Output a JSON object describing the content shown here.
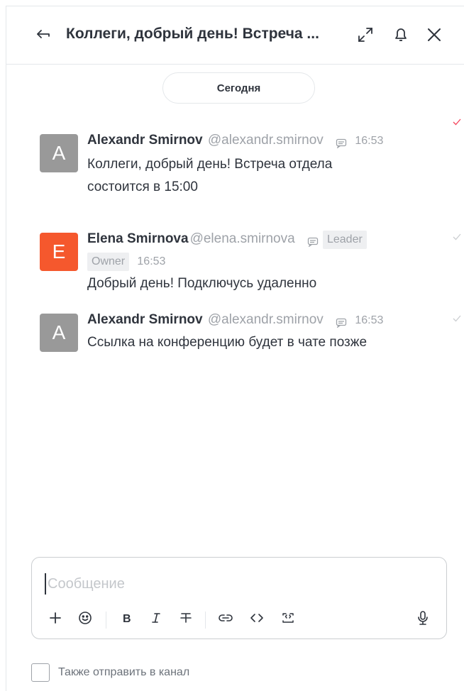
{
  "header": {
    "title": "Коллеги, добрый день! Встреча ...",
    "icons": [
      "back-arrow-icon",
      "expand-icon",
      "bell-icon",
      "close-icon"
    ]
  },
  "date_divider": "Сегодня",
  "messages": [
    {
      "avatar_letter": "A",
      "avatar_color": "#999999",
      "name": "Alexandr Smirnov",
      "handle": "@alexandr.smirnov",
      "time": "16:53",
      "text_lines": [
        "Коллеги, добрый день! Встреча отдела",
        "состоится в 15:00"
      ],
      "read_status_color": "#f5455c"
    },
    {
      "avatar_letter": "E",
      "avatar_color": "#f5582d",
      "name": "Elena Smirnova",
      "handle": "@elena.smirnova",
      "badges": [
        "Leader",
        "Owner"
      ],
      "time": "16:53",
      "text_lines": [
        "Добрый день! Подключусь удаленно"
      ],
      "read_status_color": "#cbced1"
    },
    {
      "avatar_letter": "A",
      "avatar_color": "#999999",
      "name": "Alexandr Smirnov",
      "handle": "@alexandr.smirnov",
      "time": "16:53",
      "text_lines": [
        "Ссылка на конференцию будет в чате позже"
      ],
      "read_status_color": "#cbced1"
    }
  ],
  "composer": {
    "placeholder": "Сообщение",
    "value": "",
    "toolbar": [
      "plus-icon",
      "emoji-icon",
      "bold-icon",
      "italic-icon",
      "strikethrough-icon",
      "link-icon",
      "code-icon",
      "code-block-icon",
      "microphone-icon"
    ]
  },
  "also_send": {
    "label": "Также отправить в канал",
    "checked": false
  }
}
